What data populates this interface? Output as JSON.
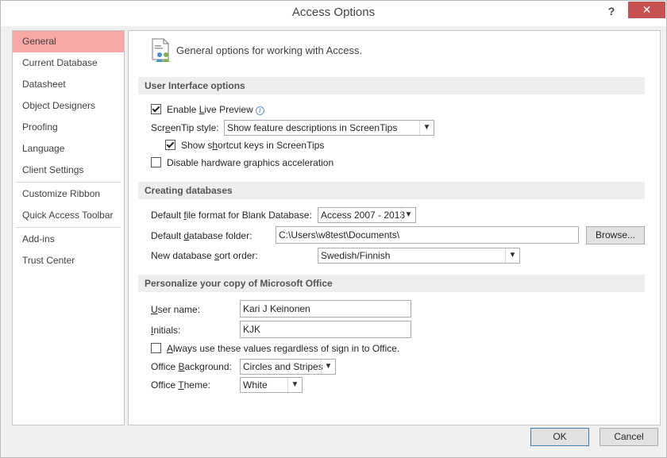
{
  "window": {
    "title": "Access Options",
    "help": "?",
    "close": "✕"
  },
  "nav": {
    "items": [
      {
        "label": "General",
        "selected": true
      },
      {
        "label": "Current Database"
      },
      {
        "label": "Datasheet"
      },
      {
        "label": "Object Designers"
      },
      {
        "label": "Proofing"
      },
      {
        "label": "Language"
      },
      {
        "label": "Client Settings"
      },
      {
        "label": "Customize Ribbon"
      },
      {
        "label": "Quick Access Toolbar"
      },
      {
        "label": "Add-ins"
      },
      {
        "label": "Trust Center"
      }
    ]
  },
  "header": {
    "text": "General options for working with Access."
  },
  "ui_options": {
    "title": "User Interface options",
    "live_preview": {
      "pre": "Enable ",
      "ul": "L",
      "post": "ive Preview",
      "checked": true
    },
    "screentip_label": {
      "pre": "Scr",
      "ul": "e",
      "post": "enTip style:"
    },
    "screentip_value": "Show feature descriptions in ScreenTips",
    "shortcut_keys": {
      "pre": "Show s",
      "ul": "h",
      "post": "ortcut keys in ScreenTips",
      "checked": true
    },
    "hw_accel": {
      "pre": "Disable hardware ",
      "ul": "g",
      "post": "raphics acceleration",
      "checked": false
    }
  },
  "creating": {
    "title": "Creating databases",
    "format_label": {
      "pre": "Default ",
      "ul": "f",
      "post": "ile format for Blank Database:"
    },
    "format_value": "Access 2007 - 2013",
    "folder_label": {
      "pre": "Default ",
      "ul": "d",
      "post": "atabase folder:"
    },
    "folder_value": "C:\\Users\\w8test\\Documents\\",
    "browse": "Browse...",
    "sort_label": {
      "pre": "New database ",
      "ul": "s",
      "post": "ort order:"
    },
    "sort_value": "Swedish/Finnish"
  },
  "personalize": {
    "title": "Personalize your copy of Microsoft Office",
    "username_label": {
      "pre": "",
      "ul": "U",
      "post": "ser name:"
    },
    "username_value": "Kari J Keinonen",
    "initials_label": {
      "pre": "",
      "ul": "I",
      "post": "nitials:"
    },
    "initials_value": "KJK",
    "always_use": {
      "pre": "",
      "ul": "A",
      "post": "lways use these values regardless of sign in to Office.",
      "checked": false
    },
    "background_label": {
      "pre": "Office ",
      "ul": "B",
      "post": "ackground:"
    },
    "background_value": "Circles and Stripes",
    "theme_label": {
      "pre": "Office ",
      "ul": "T",
      "post": "heme:"
    },
    "theme_value": "White"
  },
  "footer": {
    "ok": "OK",
    "cancel": "Cancel"
  },
  "colors": {
    "selected_nav": "#f8a6a6",
    "close_button": "#c75050",
    "section_header_bg": "#eeeeee"
  }
}
